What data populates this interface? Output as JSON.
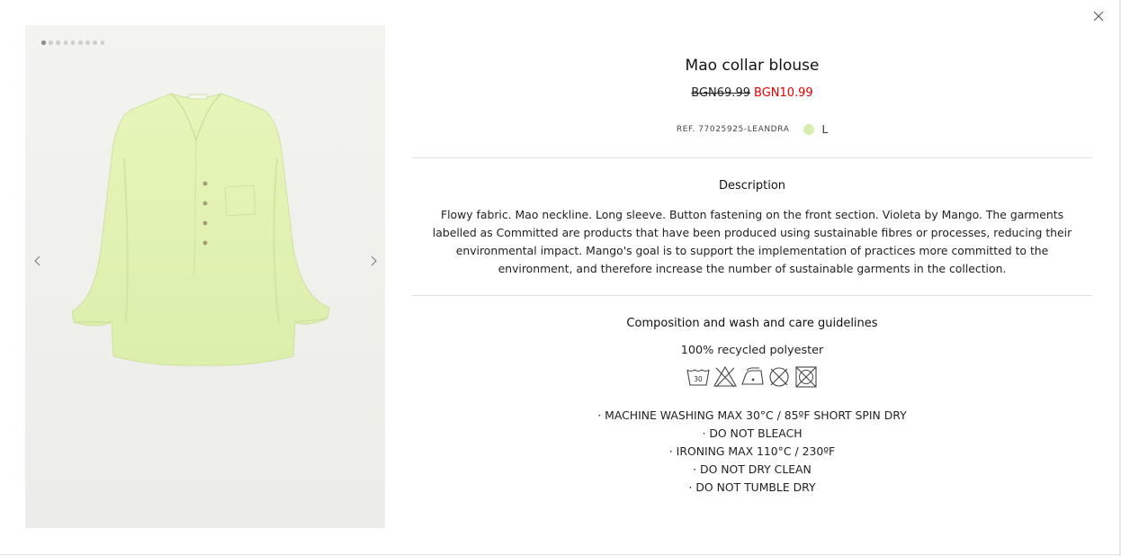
{
  "modal": {
    "close_label": "close"
  },
  "gallery": {
    "dot_count": 9,
    "active_dot": 0,
    "image_alt": "Mao collar blouse",
    "garment_color": "#e3f3b4"
  },
  "product": {
    "title": "Mao collar blouse",
    "old_price": "BGN69.99",
    "new_price": "BGN10.99",
    "ref": "REF. 77025925-LEANDRA",
    "color_swatch": "#d8edb0",
    "size": "L"
  },
  "description": {
    "heading": "Description",
    "text": "Flowy fabric. Mao neckline. Long sleeve. Button fastening on the front section. Violeta by Mango. The garments labelled as Committed are products that have been produced using sustainable fibres or processes, reducing their environmental impact. Mango's goal is to support the implementation of practices more committed to the environment, and therefore increase the number of sustainable garments in the collection."
  },
  "care": {
    "heading": "Composition and wash and care guidelines",
    "composition": "100% recycled polyester",
    "wash_temp_label": "30",
    "icons": [
      "wash-30-icon",
      "no-bleach-icon",
      "iron-low-icon",
      "no-dry-clean-icon",
      "no-tumble-dry-icon"
    ],
    "instructions": [
      "· MACHINE WASHING MAX 30°C / 85ºF SHORT SPIN DRY",
      "· DO NOT BLEACH",
      "· IRONING MAX 110°C / 230ºF",
      "· DO NOT DRY CLEAN",
      "· DO NOT TUMBLE DRY"
    ]
  },
  "colors": {
    "sale_red": "#e00000",
    "divider": "#e0e0e0"
  }
}
